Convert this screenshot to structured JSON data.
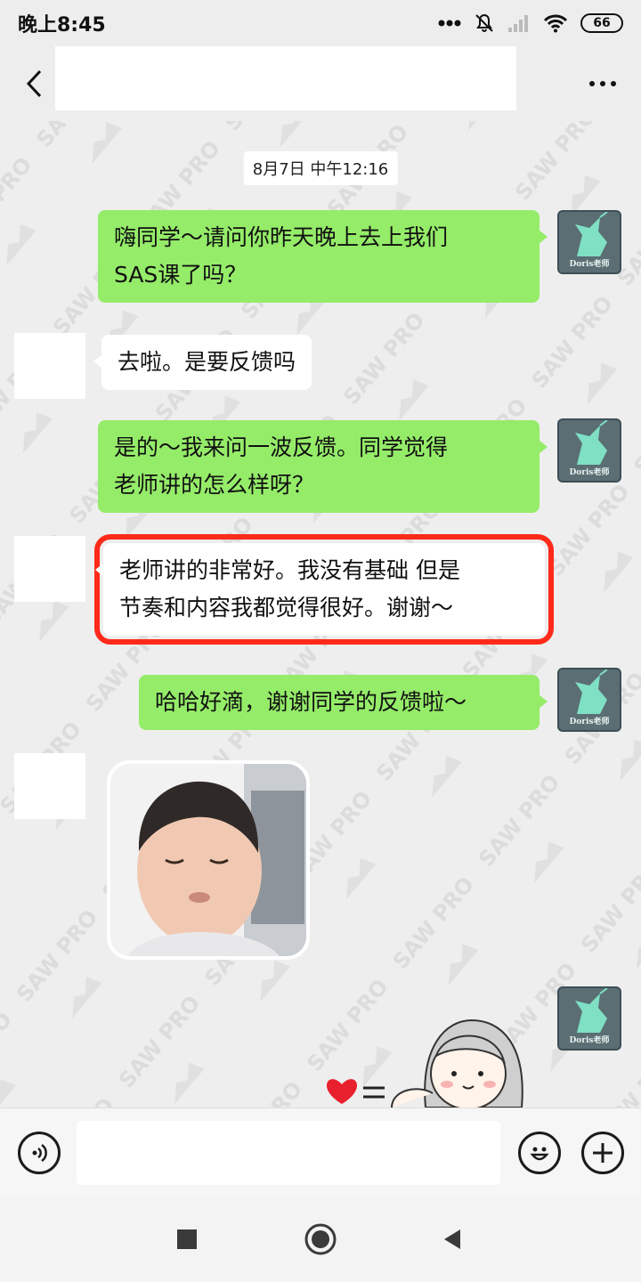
{
  "status_bar": {
    "time": "晚上8:45",
    "battery": "66",
    "icons": [
      "signal-dots-icon",
      "mute-icon",
      "cell-signal-icon",
      "wifi-icon",
      "battery-icon"
    ]
  },
  "nav": {
    "back_icon": "chevron-left-icon",
    "more_icon": "more-dots-icon"
  },
  "chat": {
    "timestamp": "8月7日 中午12:16",
    "avatar_caption": "Doris老师",
    "messages": [
      {
        "side": "right",
        "type": "text",
        "lines": [
          "嗨同学～请问你昨天晚上去上我们",
          "SAS课了吗？"
        ]
      },
      {
        "side": "left",
        "type": "text",
        "lines": [
          "去啦。是要反馈吗"
        ]
      },
      {
        "side": "right",
        "type": "text",
        "lines": [
          "是的～我来问一波反馈。同学觉得",
          "老师讲的怎么样呀？"
        ]
      },
      {
        "side": "left",
        "type": "text",
        "highlighted": true,
        "lines": [
          "老师讲的非常好。我没有基础 但是",
          "节奏和内容我都觉得很好。谢谢～"
        ]
      },
      {
        "side": "right",
        "type": "text",
        "lines": [
          "哈哈好滴，谢谢同学的反馈啦～"
        ]
      },
      {
        "side": "left",
        "type": "sticker",
        "sticker": "toddler-photo-sticker"
      },
      {
        "side": "right",
        "type": "sticker",
        "sticker": "cartoon-girl-heart-sticker"
      }
    ],
    "colors": {
      "self_bubble": "#95ec69",
      "other_bubble": "#ffffff",
      "highlight": "#ff2a1a"
    }
  },
  "input_bar": {
    "voice_icon": "voice-icon",
    "emoji_icon": "emoji-icon",
    "plus_icon": "plus-icon"
  },
  "system_nav": {
    "icons": [
      "recents-square-icon",
      "home-circle-icon",
      "back-triangle-icon"
    ]
  }
}
